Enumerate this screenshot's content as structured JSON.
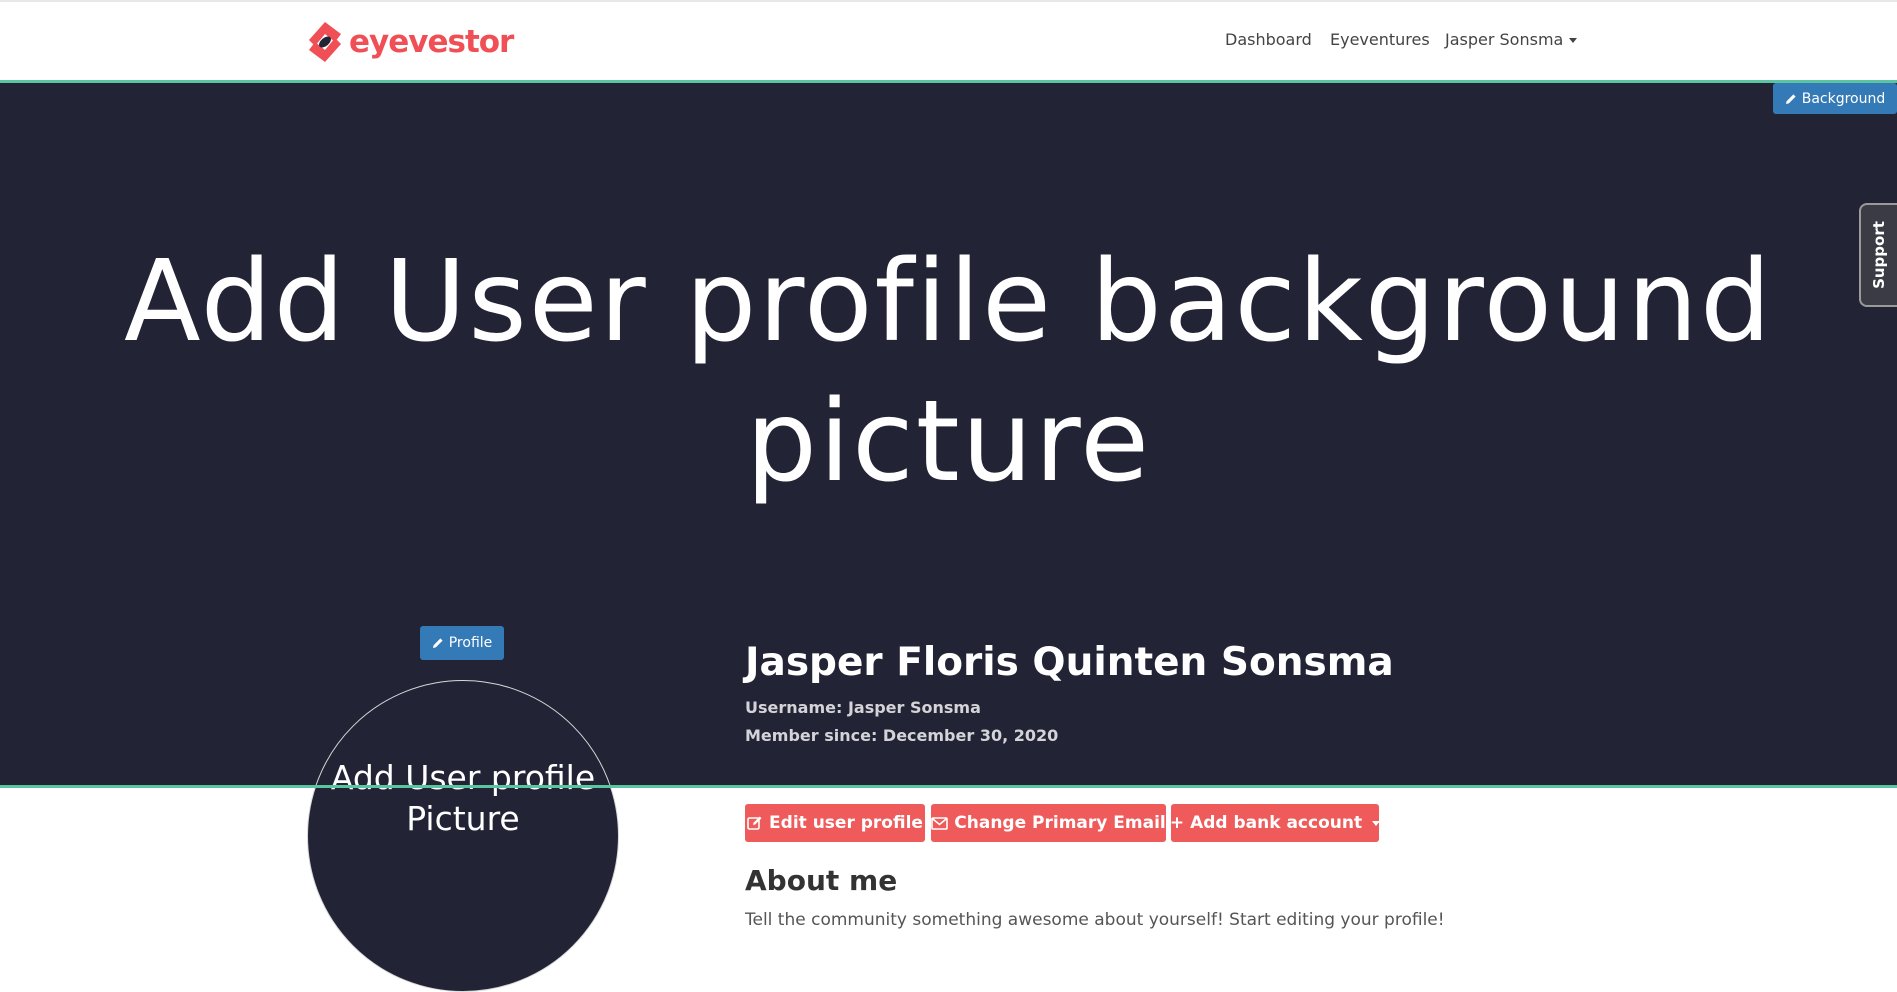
{
  "brand": {
    "name": "eyevestor",
    "accent": "#ef4f55"
  },
  "nav": {
    "dashboard": "Dashboard",
    "eyeventures": "Eyeventures",
    "user": "Jasper Sonsma"
  },
  "hero": {
    "background_button": "Background",
    "title": "Add User profile background picture",
    "support": "Support",
    "bg_color": "#222436"
  },
  "profile": {
    "profile_button": "Profile",
    "avatar_placeholder": "Add User profile Picture",
    "full_name": "Jasper Floris Quinten Sonsma",
    "username": "Username: Jasper Sonsma",
    "member_since": "Member since: December 30, 2020"
  },
  "actions": {
    "edit_profile": "Edit user profile",
    "change_email": "Change Primary Email",
    "add_bank": "+ Add bank account"
  },
  "about": {
    "heading": "About me",
    "text": "Tell the community something awesome about yourself! Start editing your profile!"
  },
  "icons": [
    "eyevestor-logo-icon",
    "pencil-icon",
    "edit-icon",
    "envelope-icon",
    "caret-down-icon"
  ]
}
